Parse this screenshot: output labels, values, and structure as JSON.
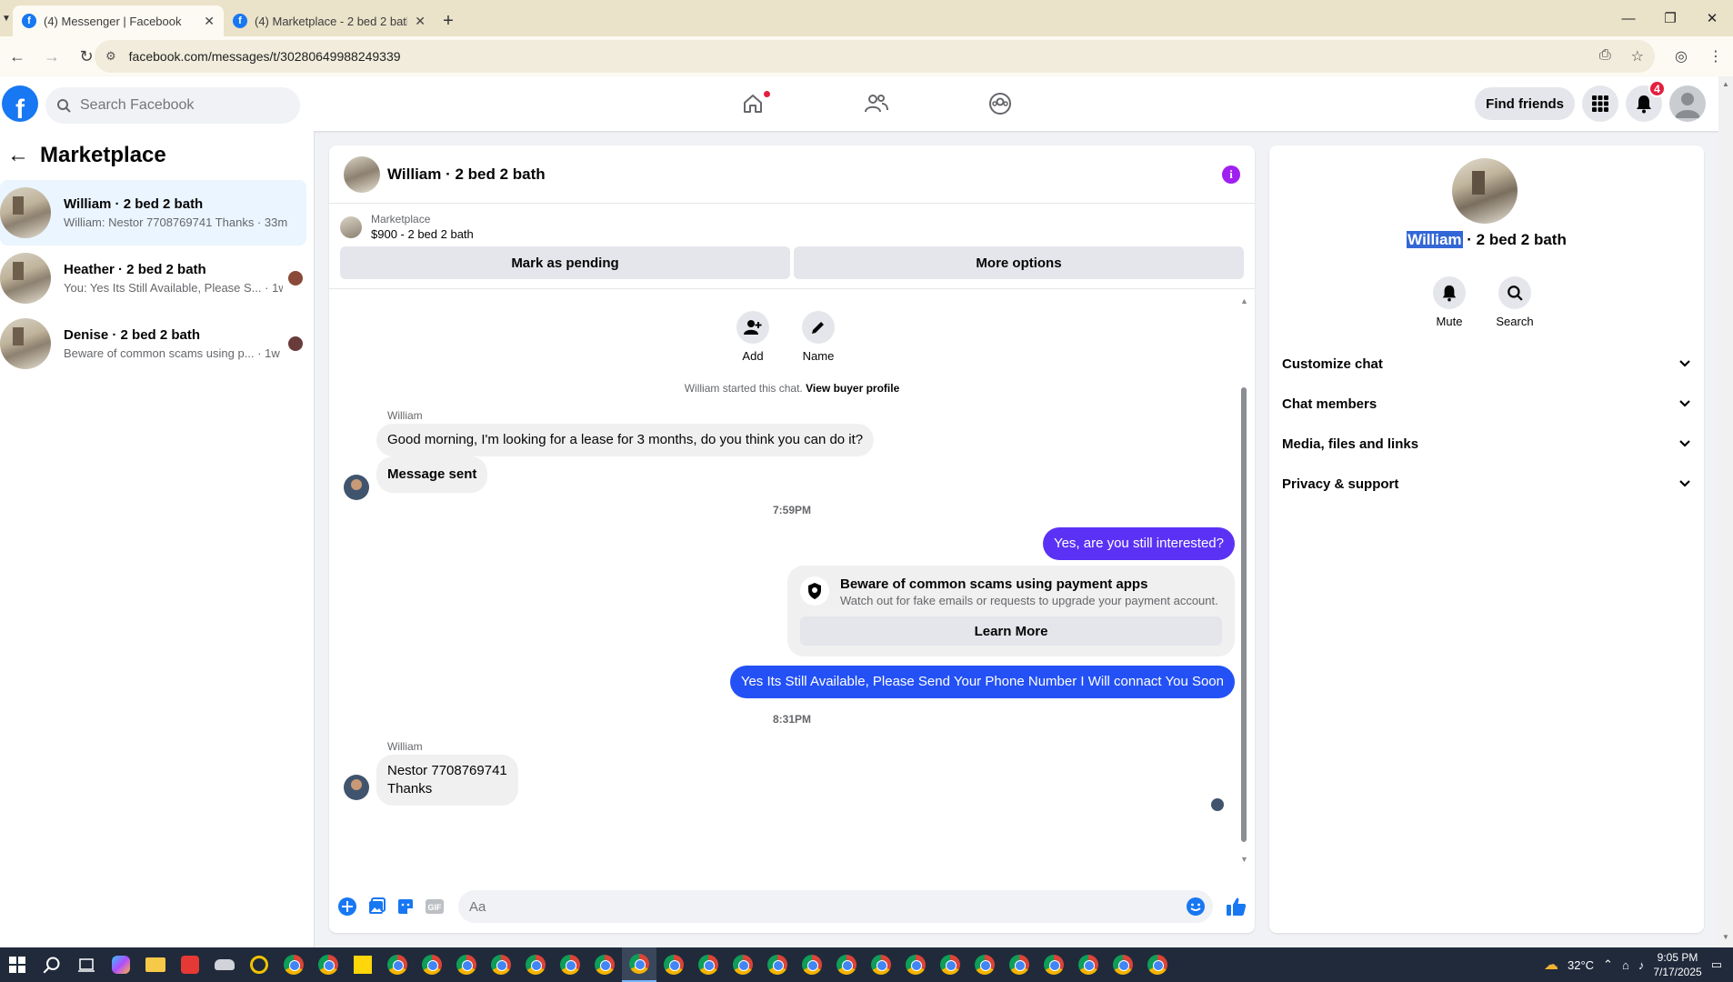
{
  "browser": {
    "tabs": [
      {
        "title": "(4) Messenger | Facebook",
        "active": true
      },
      {
        "title": "(4) Marketplace - 2 bed 2 bath |",
        "active": false
      }
    ],
    "url": "facebook.com/messages/t/30280649988249339"
  },
  "header": {
    "search_placeholder": "Search Facebook",
    "find_friends": "Find friends",
    "notification_count": "4"
  },
  "left": {
    "title": "Marketplace",
    "conversations": [
      {
        "title": "William · 2 bed 2 bath",
        "snippet": "William: Nestor 7708769741 Thanks · 33m",
        "active": true
      },
      {
        "title": "Heather · 2 bed 2 bath",
        "snippet": "You: Yes Its Still Available, Please S... · 1w",
        "active": false
      },
      {
        "title": "Denise · 2 bed 2 bath",
        "snippet": "Beware of common scams using p... · 1w",
        "active": false
      }
    ]
  },
  "chat": {
    "title": "William · 2 bed 2 bath",
    "listing_label": "Marketplace",
    "listing_price": "$900 - 2 bed 2 bath",
    "mark_pending": "Mark as pending",
    "more_options": "More options",
    "action_add": "Add",
    "action_name": "Name",
    "started_text": "William started this chat.",
    "buyer_profile": "View buyer profile",
    "sender_name": "William",
    "msg1": "Good morning, I'm looking for a lease for 3 months, do you think you can do it?",
    "msg2": "Message sent",
    "time1": "7:59PM",
    "out1": "Yes, are you still interested?",
    "scam_title": "Beware of common scams using payment apps",
    "scam_desc": "Watch out for fake emails or requests to upgrade your payment account.",
    "learn_more": "Learn More",
    "out2": "Yes Its Still Available, Please Send Your Phone Number I Will connact You Soon",
    "time2": "8:31PM",
    "msg3_line1": "Nestor 7708769741",
    "msg3_line2": "Thanks",
    "composer_placeholder": "Aa"
  },
  "right": {
    "name_highlight": "William",
    "name_rest": " · 2 bed 2 bath",
    "mute": "Mute",
    "search": "Search",
    "sections": [
      "Customize chat",
      "Chat members",
      "Media, files and links",
      "Privacy & support"
    ]
  },
  "taskbar": {
    "temperature": "32°C",
    "time": "9:05 PM",
    "date": "7/17/2025"
  },
  "colors": {
    "fb_blue": "#1877f2",
    "outgoing_purple": "#5b32f5",
    "outgoing_blue": "#2351f5",
    "badge_red": "#e41e3f"
  }
}
